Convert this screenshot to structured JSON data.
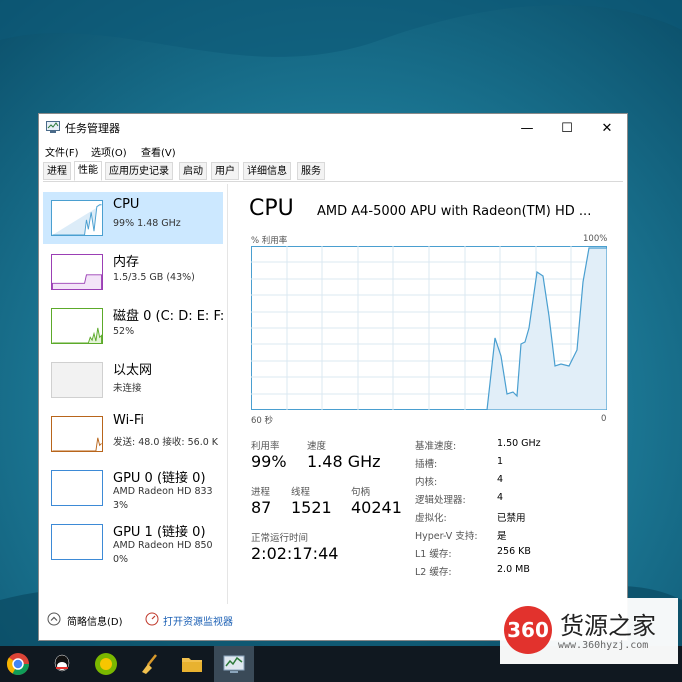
{
  "window": {
    "title": "任务管理器",
    "minimize": "—",
    "maximize": "☐",
    "close": "✕"
  },
  "menu": [
    "文件(F)",
    "选项(O)",
    "查看(V)"
  ],
  "tabs": [
    "进程",
    "性能",
    "应用历史记录",
    "启动",
    "用户",
    "详细信息",
    "服务"
  ],
  "active_tab": "性能",
  "resources": [
    {
      "name": "CPU",
      "sub": "99%  1.48 GHz",
      "sub2": ""
    },
    {
      "name": "内存",
      "sub": "1.5/3.5 GB (43%)",
      "sub2": ""
    },
    {
      "name": "磁盘 0 (C: D: E: F:",
      "sub": "52%",
      "sub2": ""
    },
    {
      "name": "以太网",
      "sub": "未连接",
      "sub2": ""
    },
    {
      "name": "Wi-Fi",
      "sub": "发送: 48.0  接收: 56.0 K",
      "sub2": ""
    },
    {
      "name": "GPU 0 (链接 0)",
      "sub": "AMD Radeon HD 833",
      "sub2": "3%"
    },
    {
      "name": "GPU 1 (链接 0)",
      "sub": "AMD Radeon HD 850",
      "sub2": "0%"
    }
  ],
  "colors": {
    "cpu": "#4a9fd0",
    "memory": "#9b3fb5",
    "disk": "#5caa2a",
    "ethernet": "#b0b0b0",
    "wifi": "#b8651b",
    "gpu": "#3d8ad6",
    "selected": "#cce8ff"
  },
  "detail": {
    "title": "CPU",
    "model": "AMD A4-5000 APU with Radeon(TM) HD ...",
    "y_label": "% 利用率",
    "y_max": "100%",
    "x_left": "60 秒",
    "x_right": "0",
    "stats": {
      "util_label": "利用率",
      "util_value": "99%",
      "speed_label": "速度",
      "speed_value": "1.48 GHz",
      "proc_label": "进程",
      "proc_value": "87",
      "thread_label": "线程",
      "thread_value": "1521",
      "handle_label": "句柄",
      "handle_value": "40241",
      "uptime_label": "正常运行时间",
      "uptime_value": "2:02:17:44"
    },
    "specs": [
      {
        "k": "基准速度:",
        "v": "1.50 GHz"
      },
      {
        "k": "插槽:",
        "v": "1"
      },
      {
        "k": "内核:",
        "v": "4"
      },
      {
        "k": "逻辑处理器:",
        "v": "4"
      },
      {
        "k": "虚拟化:",
        "v": "已禁用"
      },
      {
        "k": "Hyper-V 支持:",
        "v": "是"
      },
      {
        "k": "L1 缓存:",
        "v": "256 KB"
      },
      {
        "k": "L2 缓存:",
        "v": "2.0 MB"
      }
    ]
  },
  "footer": {
    "brief": "简略信息(D)",
    "monitor": "打开资源监视器"
  },
  "watermark": {
    "logo": "360",
    "name": "货源之家",
    "url": "www.360hyzj.com"
  }
}
